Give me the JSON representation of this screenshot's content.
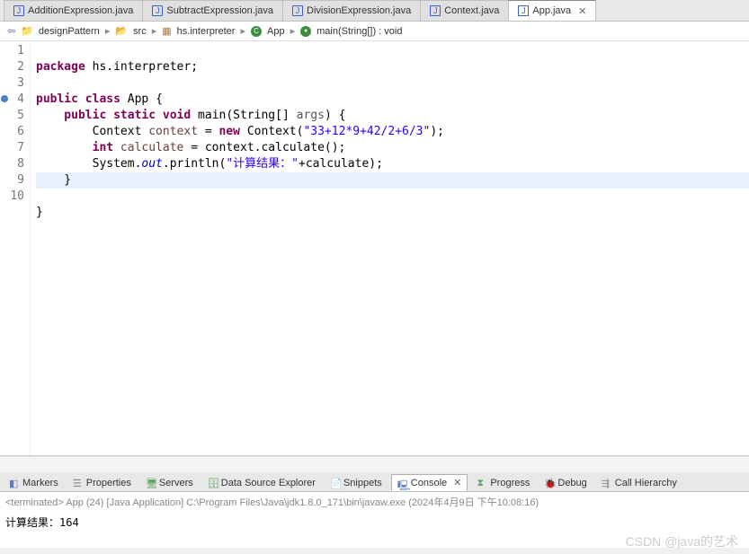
{
  "tabs": [
    {
      "label": "AdditionExpression.java"
    },
    {
      "label": "SubtractExpression.java"
    },
    {
      "label": "DivisionExpression.java"
    },
    {
      "label": "Context.java"
    },
    {
      "label": "App.java",
      "active": true
    }
  ],
  "breadcrumb": {
    "project": "designPattern",
    "src": "src",
    "pkg": "hs.interpreter",
    "cls": "App",
    "method": "main(String[]) : void"
  },
  "code": {
    "l1_package": "package",
    "l1_pkgname": " hs.interpreter;",
    "l2": "",
    "l3_public": "public",
    "l3_class": " class",
    "l3_name": " App {",
    "l4_public": "    public",
    "l4_static": " static",
    "l4_void": " void",
    "l4_main": " main(String[] ",
    "l4_args": "args",
    "l4_end": ") {",
    "l5_ctx": "        Context ",
    "l5_var": "context",
    "l5_eq": " = ",
    "l5_new": "new",
    "l5_ctx2": " Context(",
    "l5_str": "\"33+12*9+42/2+6/3\"",
    "l5_end": ");",
    "l6_int": "        int",
    "l6_var": " calculate",
    "l6_rest": " = context.calculate();",
    "l7_sys": "        System.",
    "l7_out": "out",
    "l7_pr": ".println(",
    "l7_str": "\"计算结果：\"",
    "l7_rest": "+calculate);",
    "l8": "    }",
    "l9": "}",
    "l10": ""
  },
  "lineNumbers": [
    "1",
    "2",
    "3",
    "4",
    "5",
    "6",
    "7",
    "8",
    "9",
    "10"
  ],
  "viewTabs": {
    "markers": "Markers",
    "properties": "Properties",
    "servers": "Servers",
    "dataSource": "Data Source Explorer",
    "snippets": "Snippets",
    "console": "Console",
    "progress": "Progress",
    "debug": "Debug",
    "callHierarchy": "Call Hierarchy"
  },
  "status": "<terminated> App (24) [Java Application] C:\\Program Files\\Java\\jdk1.8.0_171\\bin\\javaw.exe (2024年4月9日 下午10:08:16)",
  "consoleOut": "计算结果：164",
  "watermark": "CSDN @java的艺术"
}
